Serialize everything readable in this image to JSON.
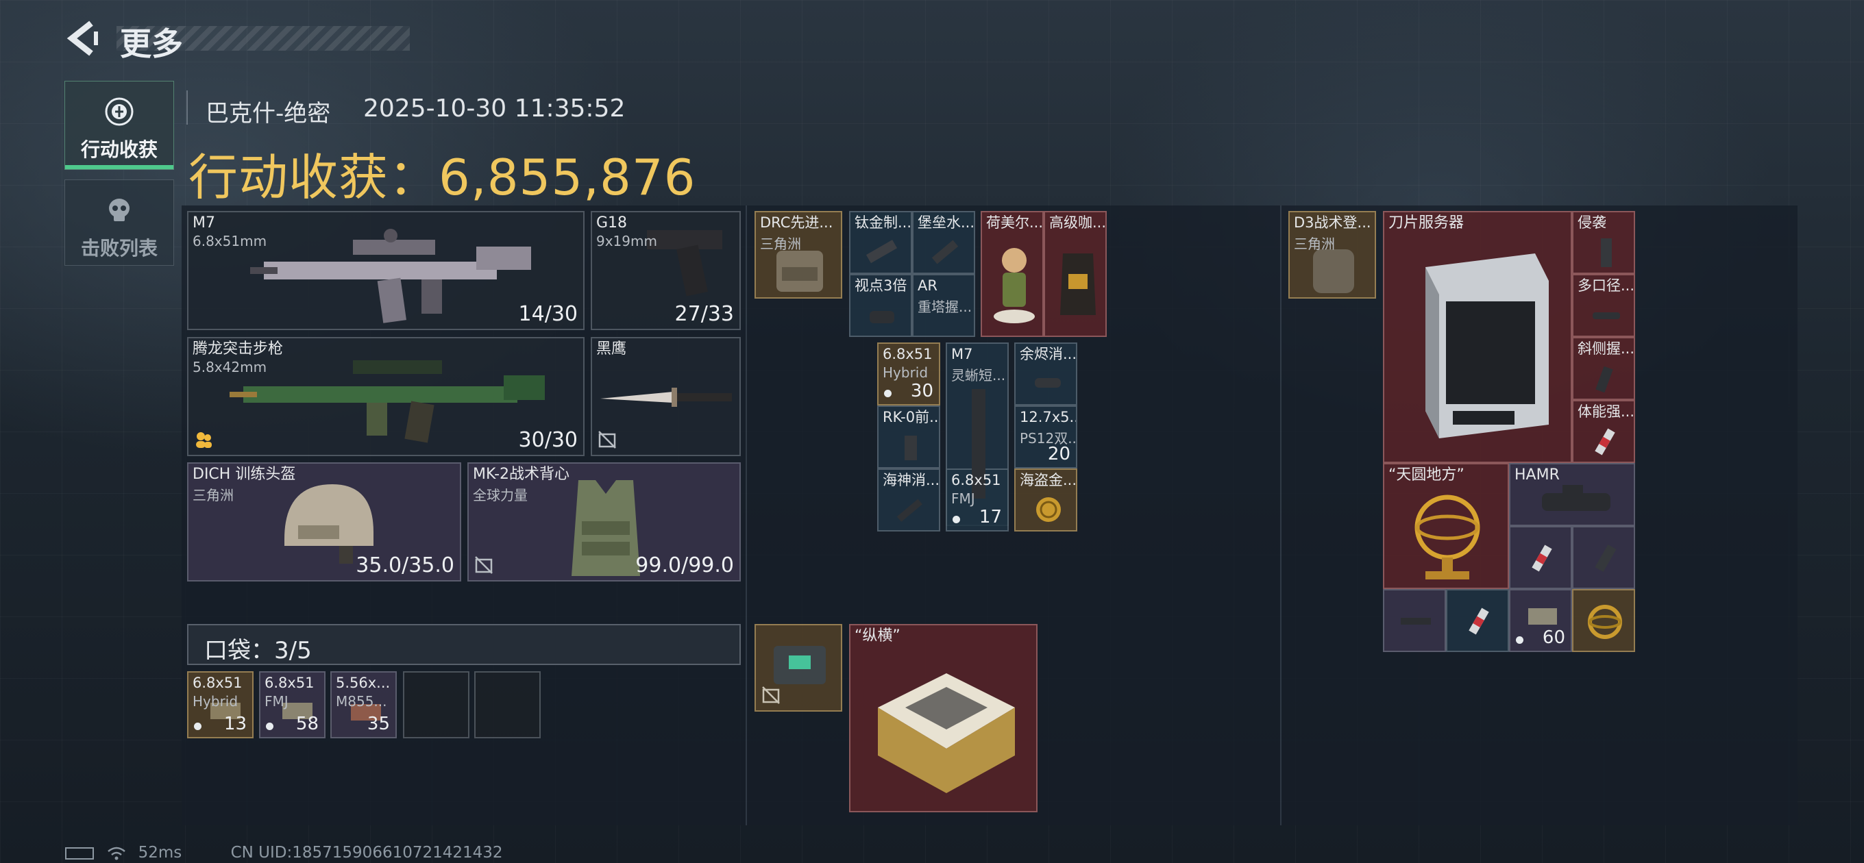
{
  "header": {
    "title": "更多",
    "back_icon": "chevron-left-icon"
  },
  "tabs": [
    {
      "label": "行动收获",
      "icon": "loot-icon",
      "active": true
    },
    {
      "label": "击败列表",
      "icon": "skull-icon",
      "active": false
    }
  ],
  "session": {
    "map": "巴克什-绝密",
    "datetime": "2025-10-30 11:35:52",
    "earnings_label": "行动收获：",
    "earnings_value": "6,855,876"
  },
  "loadout": {
    "primary": {
      "name": "M7",
      "caliber": "6.8x51mm",
      "ammo": "14/30"
    },
    "sidearm": {
      "name": "G18",
      "caliber": "9x19mm",
      "ammo": "27/33"
    },
    "secondary": {
      "name": "腾龙突击步枪",
      "caliber": "5.8x42mm",
      "ammo": "30/30"
    },
    "melee": {
      "name": "黑鹰"
    },
    "helmet": {
      "name": "DICH 训练头盔",
      "maker": "三角洲",
      "durability": "35.0/35.0"
    },
    "armor": {
      "name": "MK-2战术背心",
      "maker": "全球力量",
      "durability": "99.0/99.0"
    }
  },
  "pocket": {
    "label": "口袋：3/5",
    "items": [
      {
        "name": "6.8x51",
        "sub": "Hybrid",
        "count": "13"
      },
      {
        "name": "6.8x51",
        "sub": "FMJ",
        "count": "58"
      },
      {
        "name": "5.56x...",
        "sub": "M855...",
        "count": "35"
      }
    ]
  },
  "chest_rig": {
    "rig": {
      "name": "DRC先进...",
      "maker": "三角洲"
    },
    "items": [
      {
        "name": "钛金制..."
      },
      {
        "name": "堡垒水..."
      },
      {
        "name": "视点3倍"
      },
      {
        "name": "AR",
        "sub": "重塔握..."
      },
      {
        "name": "荷美尔..."
      },
      {
        "name": "高级咖..."
      },
      {
        "name": "6.8x51",
        "sub": "Hybrid",
        "count": "30"
      },
      {
        "name": "M7",
        "sub": "灵蜥短..."
      },
      {
        "name": "余烬消..."
      },
      {
        "name": "RK-0前..."
      },
      {
        "name": "12.7x5...",
        "sub": "PS12双...",
        "count": "20"
      },
      {
        "name": "海神消..."
      },
      {
        "name": "6.8x51",
        "sub": "FMJ",
        "count": "17"
      },
      {
        "name": "海盗金..."
      }
    ]
  },
  "safe_box": {
    "item_name": "“纵横”"
  },
  "backpack": {
    "bag": {
      "name": "D3战术登...",
      "maker": "三角洲"
    },
    "items": [
      {
        "name": "刀片服务器"
      },
      {
        "name": "侵袭"
      },
      {
        "name": "多口径..."
      },
      {
        "name": "斜侧握..."
      },
      {
        "name": "体能强..."
      },
      {
        "name": "“天圆地方”"
      },
      {
        "name": "HAMR"
      },
      {
        "name": "",
        "count": "60"
      }
    ]
  },
  "status": {
    "ping": "52ms",
    "uid": "CN UID:18571590661072142143​2"
  }
}
